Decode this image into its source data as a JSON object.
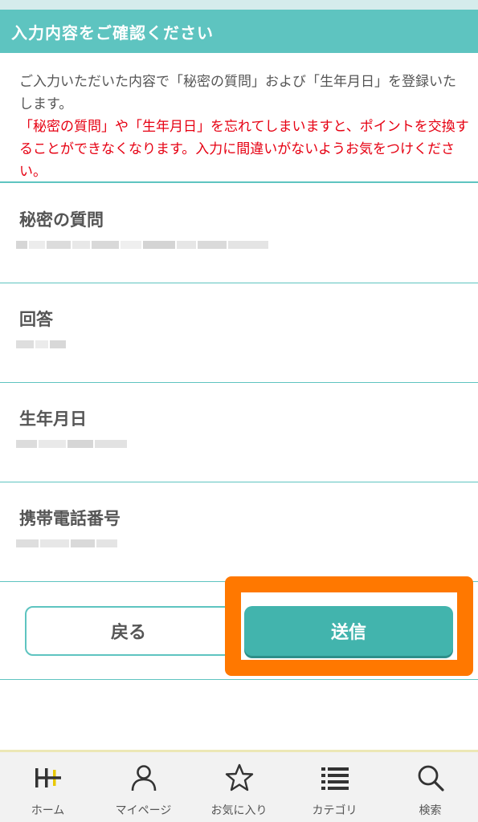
{
  "header": {
    "title": "入力内容をご確認ください"
  },
  "notice": {
    "normal": "ご入力いただいた内容で「秘密の質問」および「生年月日」を登録いたします。",
    "warning": "「秘密の質問」や「生年月日」を忘れてしまいますと、ポイントを交換することができなくなります。入力に間違いがないようお気をつけください。"
  },
  "fields": [
    {
      "label": "秘密の質問",
      "value_state": "blurred"
    },
    {
      "label": "回答",
      "value_state": "blurred"
    },
    {
      "label": "生年月日",
      "value_state": "blurred"
    },
    {
      "label": "携帯電話番号",
      "value_state": "blurred"
    }
  ],
  "buttons": {
    "back": "戻る",
    "submit": "送信"
  },
  "nav": [
    {
      "label": "ホーム",
      "icon": "home-logo-icon"
    },
    {
      "label": "マイページ",
      "icon": "person-icon"
    },
    {
      "label": "お気に入り",
      "icon": "star-icon"
    },
    {
      "label": "カテゴリ",
      "icon": "list-icon"
    },
    {
      "label": "検索",
      "icon": "search-icon"
    }
  ],
  "colors": {
    "accent": "#5ec4c0",
    "submit": "#42b4ad",
    "warning": "#e60012",
    "highlight": "#ff7800"
  }
}
